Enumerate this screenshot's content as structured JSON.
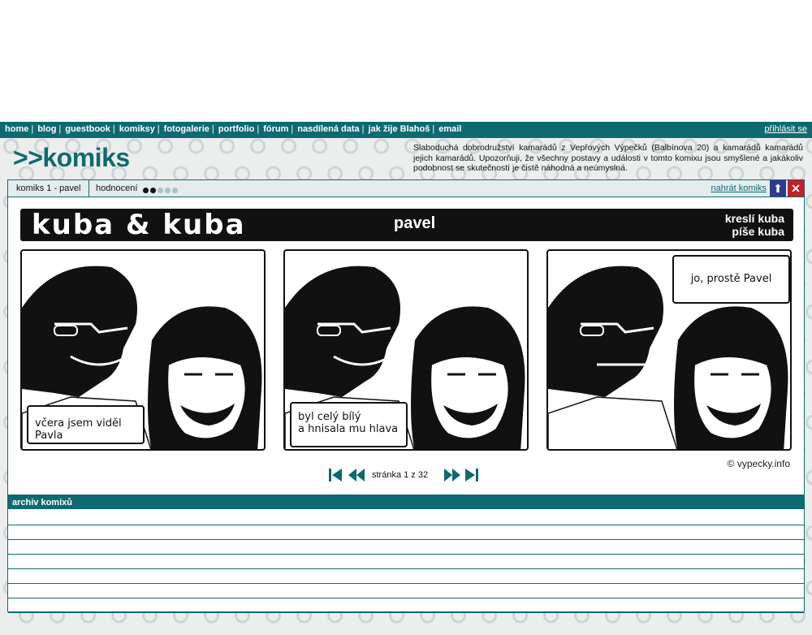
{
  "nav": {
    "links": [
      "home",
      "blog",
      "guestbook",
      "komiksy",
      "fotogalerie",
      "portfolio",
      "fórum",
      "nasdílená data",
      "jak žije Blahoš",
      "email"
    ],
    "login": "přihlásit se"
  },
  "logo": ">>komiks",
  "description": "Slaboduchá dobrodružství kamarádů z Vepřových Výpečků (Balbínova 20) a kamarádů kamarádů jejich kamarádů. Upozorňuji, že všechny postavy a události v tomto komixu jsou smyšlené a jakákoliv podobnost se skutečností je čistě náhodná a neúmyslná.",
  "tabs": {
    "current": "komiks 1 - pavel",
    "rating_label": "hodnocení",
    "rating_value": 2,
    "rating_max": 5,
    "upload": "nahrát komiks"
  },
  "comic": {
    "series": "kuba & kuba",
    "episode": "pavel",
    "drawn_by": "kreslí kuba",
    "written_by": "píše kuba",
    "bubbles": [
      "včera jsem viděl Pavla",
      "byl celý bílý",
      "a hnisala mu hlava",
      "jo, prostě Pavel"
    ],
    "copyright": "© vypecky.info"
  },
  "pager": {
    "label": "stránka 1 z 32",
    "current": 1,
    "total": 32
  },
  "archive": {
    "title": "archiv komixů",
    "rows": 7
  },
  "colors": {
    "accent": "#0e6a71",
    "up_button": "#2f3a8f",
    "close_button": "#c4202a"
  }
}
